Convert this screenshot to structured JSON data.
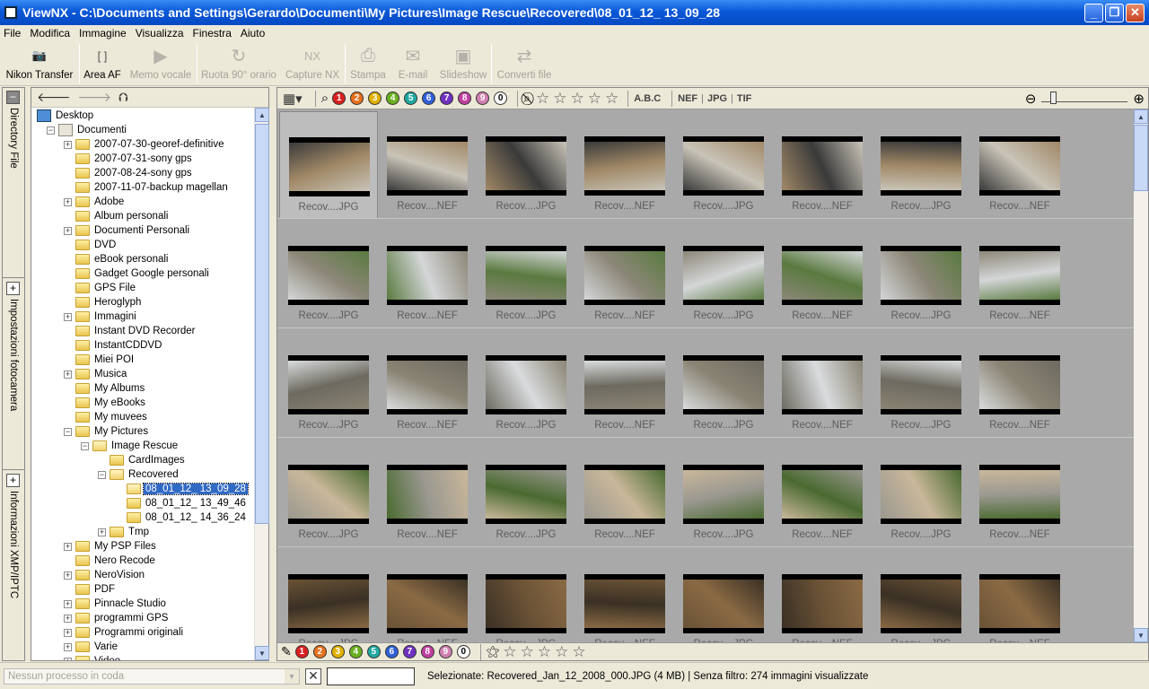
{
  "window": {
    "title": "ViewNX - C:\\Documents and Settings\\Gerardo\\Documenti\\My Pictures\\Image Rescue\\Recovered\\08_01_12_ 13_09_28"
  },
  "menu": [
    "File",
    "Modifica",
    "Immagine",
    "Visualizza",
    "Finestra",
    "Aiuto"
  ],
  "toolbar": [
    {
      "label": "Nikon Transfer",
      "icon": "camera-icon",
      "enabled": true,
      "glyph": "📷"
    },
    {
      "label": "Area AF",
      "icon": "af-area-icon",
      "enabled": true,
      "glyph": "[ ]"
    },
    {
      "label": "Memo vocale",
      "icon": "play-icon",
      "enabled": false,
      "glyph": "▶"
    },
    {
      "label": "Ruota 90° orario",
      "icon": "rotate-icon",
      "enabled": false,
      "glyph": "↻"
    },
    {
      "label": "Capture NX",
      "icon": "capture-nx-icon",
      "enabled": false,
      "glyph": "NX"
    },
    {
      "label": "Stampa",
      "icon": "print-icon",
      "enabled": false,
      "glyph": "⎙"
    },
    {
      "label": "E-mail",
      "icon": "email-icon",
      "enabled": false,
      "glyph": "✉"
    },
    {
      "label": "Slideshow",
      "icon": "slideshow-icon",
      "enabled": false,
      "glyph": "▣"
    },
    {
      "label": "Converti file",
      "icon": "convert-icon",
      "enabled": false,
      "glyph": "⇄"
    }
  ],
  "left_tabs": [
    "Directory File",
    "Impostazioni fotocamera",
    "Informazioni XMP/IPTC"
  ],
  "tree": [
    {
      "label": "Desktop",
      "level": 0,
      "icon": "desktop",
      "exp": "none"
    },
    {
      "label": "Documenti",
      "level": 1,
      "icon": "doc",
      "exp": "minus"
    },
    {
      "label": "2007-07-30-georef-definitive",
      "level": 2,
      "icon": "folder",
      "exp": "plus"
    },
    {
      "label": "2007-07-31-sony gps",
      "level": 2,
      "icon": "folder",
      "exp": "none"
    },
    {
      "label": "2007-08-24-sony gps",
      "level": 2,
      "icon": "folder",
      "exp": "none"
    },
    {
      "label": "2007-11-07-backup magellan",
      "level": 2,
      "icon": "folder",
      "exp": "none"
    },
    {
      "label": "Adobe",
      "level": 2,
      "icon": "folder",
      "exp": "plus"
    },
    {
      "label": "Album personali",
      "level": 2,
      "icon": "folder",
      "exp": "none"
    },
    {
      "label": "Documenti Personali",
      "level": 2,
      "icon": "folder",
      "exp": "plus"
    },
    {
      "label": "DVD",
      "level": 2,
      "icon": "folder",
      "exp": "none"
    },
    {
      "label": "eBook personali",
      "level": 2,
      "icon": "folder",
      "exp": "none"
    },
    {
      "label": "Gadget Google personali",
      "level": 2,
      "icon": "folder",
      "exp": "none"
    },
    {
      "label": "GPS File",
      "level": 2,
      "icon": "folder",
      "exp": "none"
    },
    {
      "label": "Heroglyph",
      "level": 2,
      "icon": "folder",
      "exp": "none"
    },
    {
      "label": "Immagini",
      "level": 2,
      "icon": "folder",
      "exp": "plus"
    },
    {
      "label": "Instant DVD Recorder",
      "level": 2,
      "icon": "folder",
      "exp": "none"
    },
    {
      "label": "InstantCDDVD",
      "level": 2,
      "icon": "folder",
      "exp": "none"
    },
    {
      "label": "Miei POI",
      "level": 2,
      "icon": "folder",
      "exp": "none"
    },
    {
      "label": "Musica",
      "level": 2,
      "icon": "folder",
      "exp": "plus"
    },
    {
      "label": "My Albums",
      "level": 2,
      "icon": "folder",
      "exp": "none"
    },
    {
      "label": "My eBooks",
      "level": 2,
      "icon": "folder",
      "exp": "none"
    },
    {
      "label": "My muvees",
      "level": 2,
      "icon": "folder",
      "exp": "none"
    },
    {
      "label": "My Pictures",
      "level": 2,
      "icon": "folder",
      "exp": "minus"
    },
    {
      "label": "Image Rescue",
      "level": 3,
      "icon": "folder-open",
      "exp": "minus"
    },
    {
      "label": "CardImages",
      "level": 4,
      "icon": "folder",
      "exp": "none"
    },
    {
      "label": "Recovered",
      "level": 4,
      "icon": "folder-open",
      "exp": "minus"
    },
    {
      "label": "08_01_12_ 13_09_28",
      "level": 5,
      "icon": "folder-open",
      "exp": "none",
      "selected": true
    },
    {
      "label": "08_01_12_ 13_49_46",
      "level": 5,
      "icon": "folder",
      "exp": "none"
    },
    {
      "label": "08_01_12_ 14_36_24",
      "level": 5,
      "icon": "folder",
      "exp": "none"
    },
    {
      "label": "Tmp",
      "level": 4,
      "icon": "folder",
      "exp": "plus"
    },
    {
      "label": "My PSP Files",
      "level": 2,
      "icon": "folder",
      "exp": "plus"
    },
    {
      "label": "Nero Recode",
      "level": 2,
      "icon": "folder",
      "exp": "none"
    },
    {
      "label": "NeroVision",
      "level": 2,
      "icon": "folder",
      "exp": "plus"
    },
    {
      "label": "PDF",
      "level": 2,
      "icon": "folder",
      "exp": "none"
    },
    {
      "label": "Pinnacle Studio",
      "level": 2,
      "icon": "folder",
      "exp": "plus"
    },
    {
      "label": "programmi GPS",
      "level": 2,
      "icon": "folder",
      "exp": "plus"
    },
    {
      "label": "Programmi originali",
      "level": 2,
      "icon": "folder",
      "exp": "plus"
    },
    {
      "label": "Varie",
      "level": 2,
      "icon": "folder",
      "exp": "plus"
    },
    {
      "label": "Video",
      "level": 2,
      "icon": "folder",
      "exp": "plus"
    }
  ],
  "filter": {
    "label_colors": [
      {
        "n": "1",
        "c": "#d82020"
      },
      {
        "n": "2",
        "c": "#e8701c"
      },
      {
        "n": "3",
        "c": "#e0b000"
      },
      {
        "n": "4",
        "c": "#6ab020"
      },
      {
        "n": "5",
        "c": "#20a8a0"
      },
      {
        "n": "6",
        "c": "#3060d8"
      },
      {
        "n": "7",
        "c": "#7030c0"
      },
      {
        "n": "8",
        "c": "#c040a0"
      },
      {
        "n": "9",
        "c": "#d080b0"
      },
      {
        "n": "0",
        "c": "#ffffff"
      }
    ],
    "abc": "A.B.C",
    "formats": [
      "NEF",
      "JPG",
      "TIF"
    ]
  },
  "thumb_rows": [
    {
      "captions": [
        "Recov....JPG",
        "Recov....NEF",
        "Recov....JPG",
        "Recov....NEF",
        "Recov....JPG",
        "Recov....NEF",
        "Recov....JPG",
        "Recov....NEF"
      ],
      "palette": [
        "#3a3a3a",
        "#a08866",
        "#c9c4b8"
      ]
    },
    {
      "captions": [
        "Recov....JPG",
        "Recov....NEF",
        "Recov....JPG",
        "Recov....NEF",
        "Recov....JPG",
        "Recov....NEF",
        "Recov....JPG",
        "Recov....NEF"
      ],
      "palette": [
        "#5a7a40",
        "#8c8778",
        "#d4d6d8"
      ]
    },
    {
      "captions": [
        "Recov....JPG",
        "Recov....NEF",
        "Recov....JPG",
        "Recov....NEF",
        "Recov....JPG",
        "Recov....NEF",
        "Recov....JPG",
        "Recov....NEF"
      ],
      "palette": [
        "#d9dcde",
        "#6d6a60",
        "#8a8474"
      ]
    },
    {
      "captions": [
        "Recov....JPG",
        "Recov....NEF",
        "Recov....JPG",
        "Recov....NEF",
        "Recov....JPG",
        "Recov....NEF",
        "Recov....JPG",
        "Recov....NEF"
      ],
      "palette": [
        "#4a6a30",
        "#c9b79a",
        "#9a9890"
      ]
    },
    {
      "captions": [
        "Recov....JPG",
        "Recov....NEF",
        "Recov....JPG",
        "Recov....NEF",
        "Recov....JPG",
        "Recov....NEF",
        "Recov....JPG",
        "Recov....NEF"
      ],
      "palette": [
        "#6a5236",
        "#3a3024",
        "#8a6a44"
      ]
    }
  ],
  "status": {
    "queue_placeholder": "Nessun processo in coda",
    "selection": "Selezionate: Recovered_Jan_12_2008_000.JPG (4 MB) | Senza filtro: 274 immagini visualizzate"
  }
}
